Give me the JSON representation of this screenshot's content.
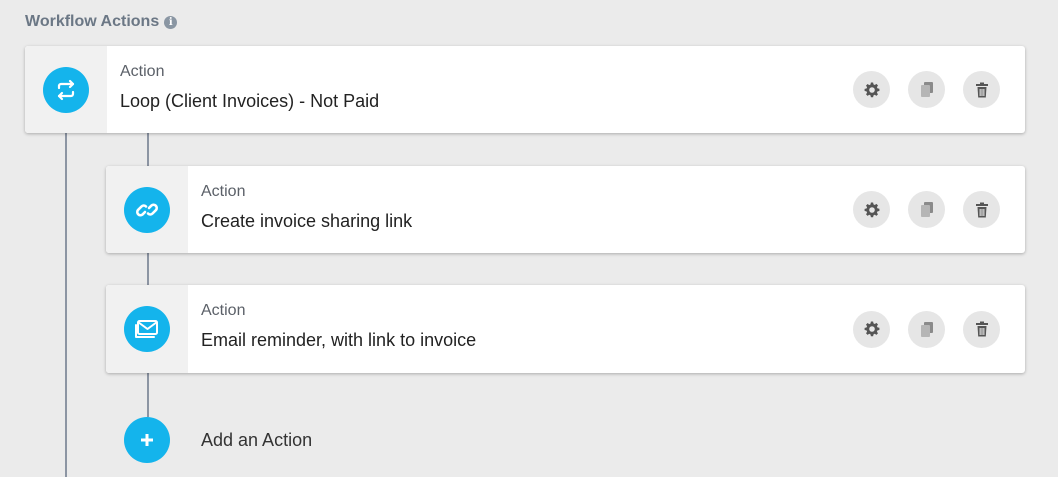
{
  "header": {
    "title": "Workflow Actions",
    "info_icon": "info-icon"
  },
  "actions": [
    {
      "kind": "Action",
      "title": "Loop (Client Invoices) - Not Paid",
      "icon": "loop-icon"
    },
    {
      "kind": "Action",
      "title": "Create invoice sharing link",
      "icon": "link-icon"
    },
    {
      "kind": "Action",
      "title": "Email reminder, with link to invoice",
      "icon": "email-icon"
    }
  ],
  "add_action": {
    "label": "Add an Action",
    "icon": "plus-icon"
  },
  "colors": {
    "accent": "#14b4ec",
    "connector": "#8c95a3",
    "background": "#ebebeb"
  }
}
